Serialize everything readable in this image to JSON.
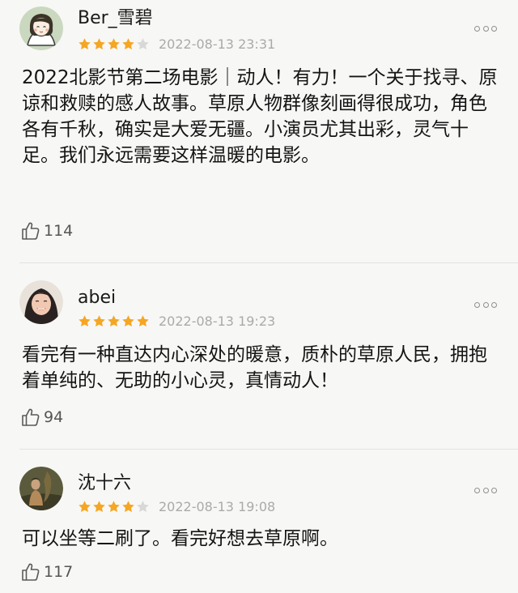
{
  "reviews": [
    {
      "username": "Ber_雪碧",
      "rating": 4,
      "timestamp": "2022-08-13 23:31",
      "text": "2022北影节第二场电影｜动人！有力！一个关于找寻、原谅和救赎的感人故事。草原人物群像刻画得很成功，角色各有千秋，确实是大爱无疆。小演员尤其出彩，灵气十足。我们永远需要这样温暖的电影。",
      "likes": "114"
    },
    {
      "username": "abei",
      "rating": 5,
      "timestamp": "2022-08-13 19:23",
      "text": "看完有一种直达内心深处的暖意，质朴的草原人民，拥抱着单纯的、无助的小心灵，真情动人！",
      "likes": "94"
    },
    {
      "username": "沈十六",
      "rating": 4,
      "timestamp": "2022-08-13 19:08",
      "text": "可以坐等二刷了。看完好想去草原啊。",
      "likes": "117"
    }
  ],
  "colors": {
    "star_filled": "#f5a623",
    "star_empty": "#d8d8d8",
    "background": "#f7f7f5"
  },
  "icons": {
    "like": "thumbs-up-icon",
    "more": "more-dots-icon",
    "star": "star-icon"
  }
}
